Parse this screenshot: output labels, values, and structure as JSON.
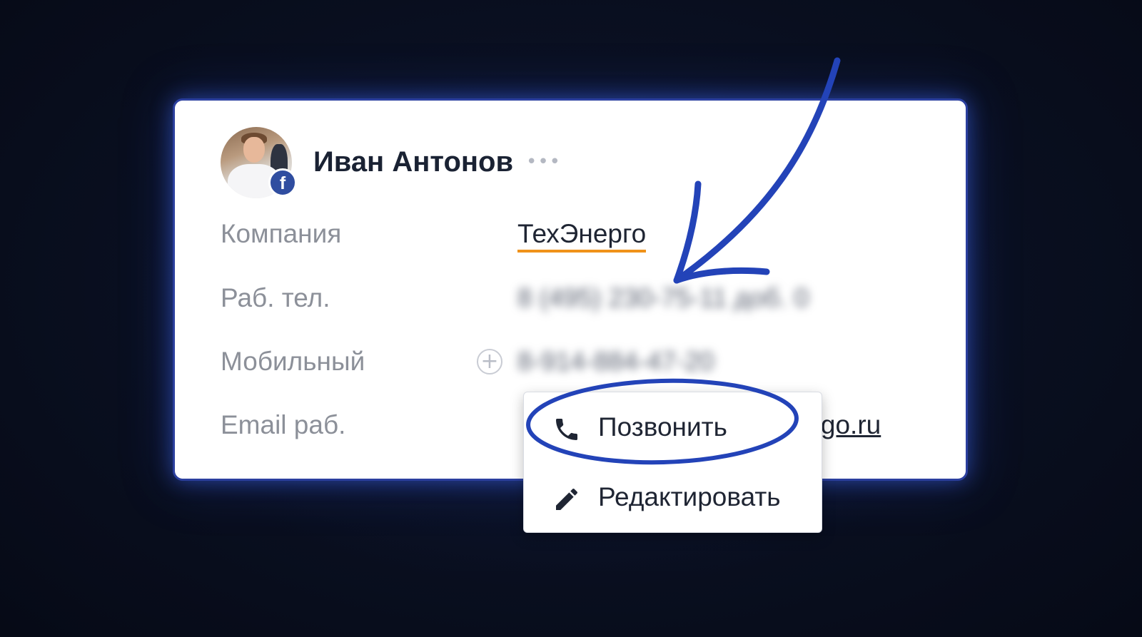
{
  "contact": {
    "name": "Иван Антонов",
    "more_label": "•••",
    "social_badge": "f"
  },
  "fields": {
    "company": {
      "label": "Компания",
      "value": "ТехЭнерго"
    },
    "work_phone": {
      "label": "Раб. тел.",
      "value": "8 (495) 230-75-11 доб. 0"
    },
    "mobile": {
      "label": "Мобильный",
      "value": "8-914-884-47-20",
      "add_symbol": "+"
    },
    "work_email": {
      "label": "Email раб.",
      "value": "ergo.ru"
    }
  },
  "menu": {
    "items": [
      {
        "label": "Позвонить",
        "icon": "phone-icon"
      },
      {
        "label": "Редактировать",
        "icon": "pencil-icon"
      }
    ]
  },
  "colors": {
    "background": "#0a1022",
    "card_border": "#2b3f9e",
    "annotation": "#2343b8",
    "company_underline": "#f0921a",
    "facebook": "#2f4da0"
  }
}
